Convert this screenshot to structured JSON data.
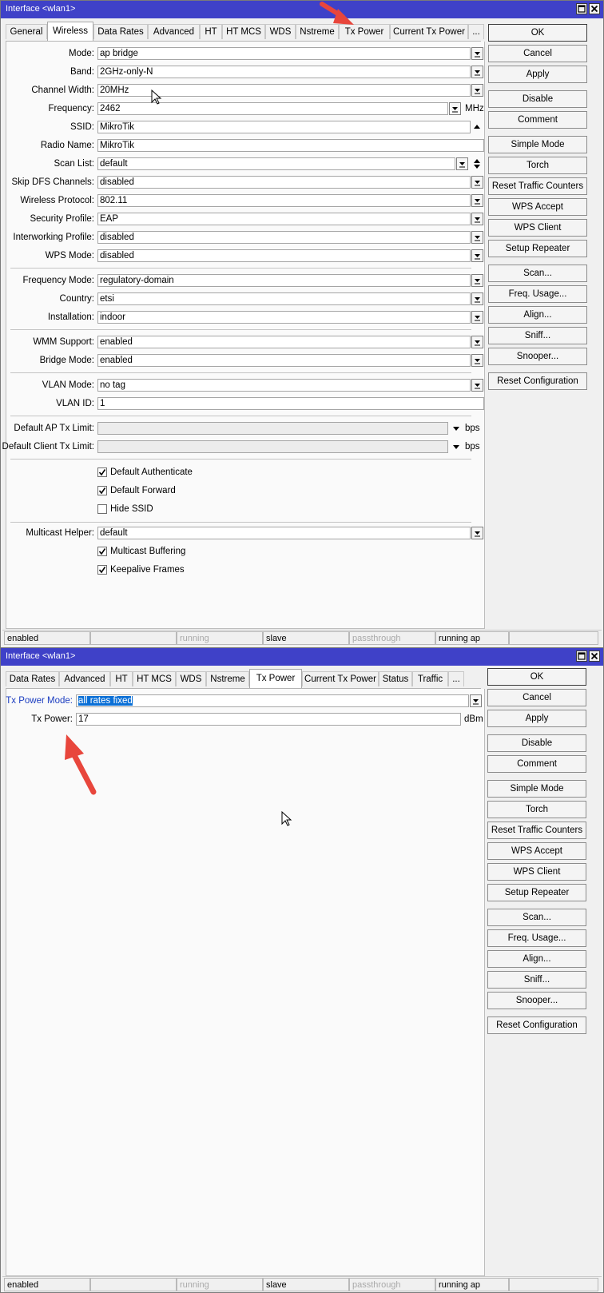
{
  "window1": {
    "title": "Interface <wlan1>",
    "tabs": [
      {
        "label": "General"
      },
      {
        "label": "Wireless",
        "active": true
      },
      {
        "label": "Data Rates"
      },
      {
        "label": "Advanced"
      },
      {
        "label": "HT"
      },
      {
        "label": "HT MCS"
      },
      {
        "label": "WDS"
      },
      {
        "label": "Nstreme"
      },
      {
        "label": "Tx Power"
      },
      {
        "label": "Current Tx Power"
      },
      {
        "label": "..."
      }
    ],
    "fields": {
      "mode": {
        "label": "Mode:",
        "value": "ap bridge"
      },
      "band": {
        "label": "Band:",
        "value": "2GHz-only-N"
      },
      "channel_width": {
        "label": "Channel Width:",
        "value": "20MHz"
      },
      "frequency": {
        "label": "Frequency:",
        "value": "2462",
        "unit": "MHz"
      },
      "ssid": {
        "label": "SSID:",
        "value": "MikroTik"
      },
      "radio_name": {
        "label": "Radio Name:",
        "value": "MikroTik"
      },
      "scan_list": {
        "label": "Scan List:",
        "value": "default"
      },
      "skip_dfs": {
        "label": "Skip DFS Channels:",
        "value": "disabled"
      },
      "wireless_protocol": {
        "label": "Wireless Protocol:",
        "value": "802.11"
      },
      "security_profile": {
        "label": "Security Profile:",
        "value": "EAP"
      },
      "interworking_profile": {
        "label": "Interworking Profile:",
        "value": "disabled"
      },
      "wps_mode": {
        "label": "WPS Mode:",
        "value": "disabled"
      },
      "frequency_mode": {
        "label": "Frequency Mode:",
        "value": "regulatory-domain"
      },
      "country": {
        "label": "Country:",
        "value": "etsi"
      },
      "installation": {
        "label": "Installation:",
        "value": "indoor"
      },
      "wmm_support": {
        "label": "WMM Support:",
        "value": "enabled"
      },
      "bridge_mode": {
        "label": "Bridge Mode:",
        "value": "enabled"
      },
      "vlan_mode": {
        "label": "VLAN Mode:",
        "value": "no tag"
      },
      "vlan_id": {
        "label": "VLAN ID:",
        "value": "1"
      },
      "default_ap_tx_limit": {
        "label": "Default AP Tx Limit:",
        "value": "",
        "unit": "bps"
      },
      "default_client_tx_limit": {
        "label": "Default Client Tx Limit:",
        "value": "",
        "unit": "bps"
      },
      "multicast_helper": {
        "label": "Multicast Helper:",
        "value": "default"
      }
    },
    "checkboxes": {
      "default_authenticate": {
        "label": "Default Authenticate",
        "checked": true
      },
      "default_forward": {
        "label": "Default Forward",
        "checked": true
      },
      "hide_ssid": {
        "label": "Hide SSID",
        "checked": false
      },
      "multicast_buffering": {
        "label": "Multicast Buffering",
        "checked": true
      },
      "keepalive_frames": {
        "label": "Keepalive Frames",
        "checked": true
      }
    },
    "status": [
      "enabled",
      "",
      "running",
      "slave",
      "passthrough",
      "running ap",
      ""
    ]
  },
  "window2": {
    "title": "Interface <wlan1>",
    "tabs": [
      {
        "label": "Data Rates"
      },
      {
        "label": "Advanced"
      },
      {
        "label": "HT"
      },
      {
        "label": "HT MCS"
      },
      {
        "label": "WDS"
      },
      {
        "label": "Nstreme"
      },
      {
        "label": "Tx Power",
        "active": true
      },
      {
        "label": "Current Tx Power"
      },
      {
        "label": "Status"
      },
      {
        "label": "Traffic"
      },
      {
        "label": "..."
      }
    ],
    "fields": {
      "tx_power_mode": {
        "label": "Tx Power Mode:",
        "value": "all rates fixed"
      },
      "tx_power": {
        "label": "Tx Power:",
        "value": "17",
        "unit": "dBm"
      }
    },
    "status": [
      "enabled",
      "",
      "running",
      "slave",
      "passthrough",
      "running ap",
      ""
    ]
  },
  "buttons": [
    "OK",
    "Cancel",
    "Apply",
    "Disable",
    "Comment",
    "Simple Mode",
    "Torch",
    "Reset Traffic Counters",
    "WPS Accept",
    "WPS Client",
    "Setup Repeater",
    "Scan...",
    "Freq. Usage...",
    "Align...",
    "Sniff...",
    "Snooper...",
    "Reset Configuration"
  ],
  "icons": {
    "maximize": "maximize-icon",
    "close": "close-icon",
    "dropdown": "dropdown-arrow-icon",
    "annotation": "red-arrow-icon",
    "pointer": "mouse-cursor-icon"
  },
  "colors": {
    "titlebar": "#3f41c8",
    "annotation_arrow": "#e8463c",
    "selection": "#0a6fd6",
    "label_highlight": "#1a3cc0"
  }
}
